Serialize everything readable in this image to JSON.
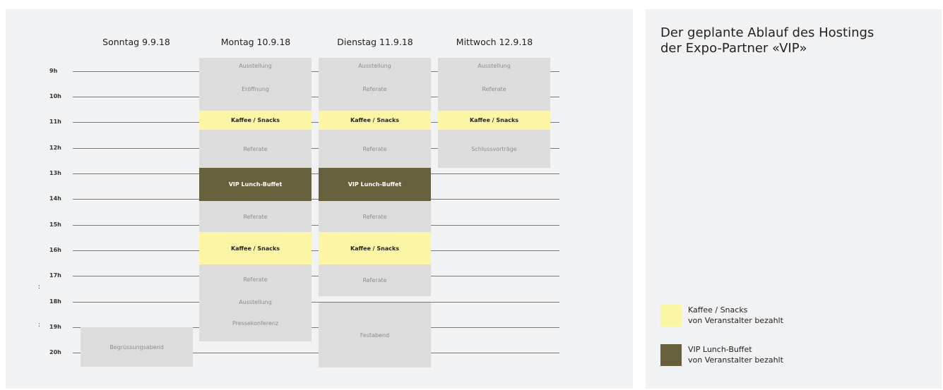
{
  "days": [
    {
      "label": "Sonntag 9.9.18"
    },
    {
      "label": "Montag 10.9.18"
    },
    {
      "label": "Dienstag 11.9.18"
    },
    {
      "label": "Mittwoch 12.9.18"
    }
  ],
  "hours": [
    "9h",
    "10h",
    "11h",
    "12h",
    "13h",
    "14h",
    "15h",
    "16h",
    "17h",
    "18h",
    "19h",
    "20h"
  ],
  "info": {
    "title_line1": "Der geplante Ablauf des Hostings",
    "title_line2": "der Expo-Partner «VIP»"
  },
  "legend": {
    "snacks": {
      "line1": "Kaffee / Snacks",
      "line2": "von Veranstalter bezahlt",
      "color": "#fdf5a6"
    },
    "lunch": {
      "line1": "VIP Lunch-Buffet",
      "line2": "von Veranstalter bezahlt",
      "color": "#67603c"
    }
  },
  "schedule": {
    "sonntag": {
      "begruessung": "Begrüssungsabend"
    },
    "montag": {
      "ausstellung": "Ausstellung",
      "eroeffnung": "Eröffnung",
      "kaffee1": "Kaffee / Snacks",
      "referate1": "Referate",
      "lunch": "VIP Lunch-Buffet",
      "referate2": "Referate",
      "kaffee2": "Kaffee / Snacks",
      "referate3": "Referate",
      "ausstellung2": "Ausstellung",
      "presse": "Pressekonferenz"
    },
    "dienstag": {
      "ausstellung": "Ausstellung",
      "referate1": "Referate",
      "kaffee1": "Kaffee / Snacks",
      "referate2": "Referate",
      "lunch": "VIP Lunch-Buffet",
      "referate3": "Referate",
      "kaffee2": "Kaffee / Snacks",
      "referate4": "Referate",
      "festabend": "Festabend"
    },
    "mittwoch": {
      "ausstellung": "Ausstellung",
      "referate": "Referate",
      "kaffee": "Kaffee / Snacks",
      "schluss": "Schlussvorträge"
    }
  }
}
